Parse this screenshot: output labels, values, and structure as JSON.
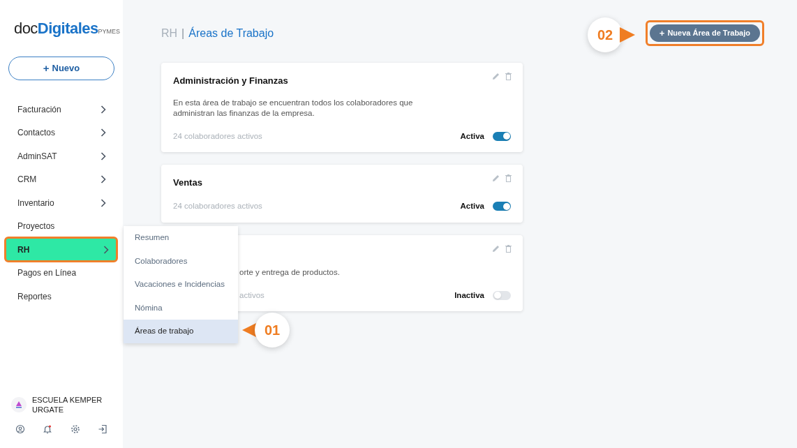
{
  "logo": {
    "part_1": "doc",
    "part_2": "Digitales",
    "part_3": "PYMES"
  },
  "new_button": {
    "icon": "+",
    "label": "Nuevo"
  },
  "sidebar": {
    "items": [
      {
        "label": "Facturación",
        "has_chevron": true,
        "selected": false
      },
      {
        "label": "Contactos",
        "has_chevron": true,
        "selected": false
      },
      {
        "label": "AdminSAT",
        "has_chevron": true,
        "selected": false
      },
      {
        "label": "CRM",
        "has_chevron": true,
        "selected": false
      },
      {
        "label": "Inventario",
        "has_chevron": true,
        "selected": false
      },
      {
        "label": "Proyectos",
        "has_chevron": false,
        "selected": false
      },
      {
        "label": "RH",
        "has_chevron": true,
        "selected": true,
        "highlighted": true
      },
      {
        "label": "Pagos en Línea",
        "has_chevron": false,
        "selected": false
      },
      {
        "label": "Reportes",
        "has_chevron": false,
        "selected": false
      }
    ]
  },
  "submenu": {
    "items": [
      {
        "label": "Resumen",
        "selected": false
      },
      {
        "label": "Colaboradores",
        "selected": false
      },
      {
        "label": "Vacaciones e Incidencias",
        "selected": false
      },
      {
        "label": "Nómina",
        "selected": false
      },
      {
        "label": "Áreas de trabajo",
        "selected": true
      }
    ]
  },
  "account": {
    "name": "ESCUELA KEMPER URGATE"
  },
  "breadcrumb": {
    "parent": "RH",
    "separator": "|",
    "current": "Áreas de Trabajo"
  },
  "add_button": {
    "icon": "+",
    "label": "Nueva Área de Trabajo",
    "highlighted": true
  },
  "cards": [
    {
      "title": "Administración y Finanzas",
      "description": "En esta área de trabajo se encuentran todos los colaboradores que administran las finanzas de la empresa.",
      "count": "24 colaboradores activos",
      "status": "Activa",
      "on": true,
      "covered": false
    },
    {
      "title": "Ventas",
      "count": "24 colaboradores activos",
      "status": "Activa",
      "on": true,
      "covered": false
    },
    {
      "description": "orte y entrega de productos.",
      "count": "activos",
      "status": "Inactiva",
      "on": false,
      "covered": true
    }
  ],
  "callouts": [
    {
      "number": "01"
    },
    {
      "number": "02"
    }
  ]
}
